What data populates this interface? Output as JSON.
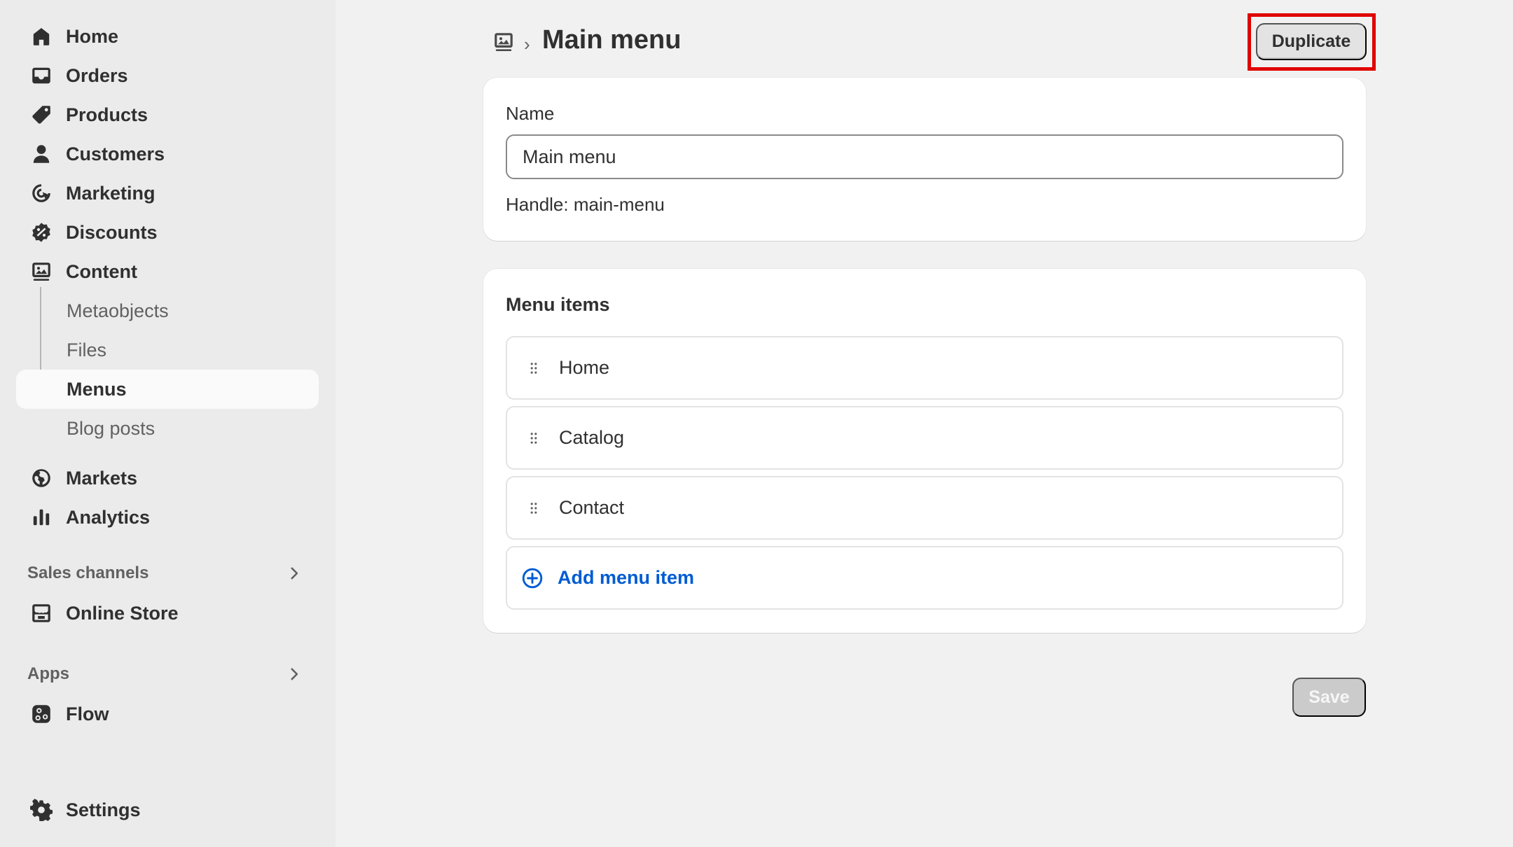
{
  "sidebar": {
    "items": [
      {
        "label": "Home",
        "icon": "home-icon"
      },
      {
        "label": "Orders",
        "icon": "inbox-icon"
      },
      {
        "label": "Products",
        "icon": "tag-icon"
      },
      {
        "label": "Customers",
        "icon": "person-icon"
      },
      {
        "label": "Marketing",
        "icon": "target-icon"
      },
      {
        "label": "Discounts",
        "icon": "discount-icon"
      },
      {
        "label": "Content",
        "icon": "content-icon"
      }
    ],
    "content_sub": [
      {
        "label": "Metaobjects"
      },
      {
        "label": "Files"
      },
      {
        "label": "Menus",
        "active": true
      },
      {
        "label": "Blog posts"
      }
    ],
    "items2": [
      {
        "label": "Markets",
        "icon": "globe-icon"
      },
      {
        "label": "Analytics",
        "icon": "bar-chart-icon"
      }
    ],
    "sales_channels": {
      "header": "Sales channels",
      "items": [
        {
          "label": "Online Store",
          "icon": "store-icon"
        }
      ]
    },
    "apps": {
      "header": "Apps",
      "items": [
        {
          "label": "Flow",
          "icon": "flow-icon"
        }
      ]
    },
    "settings": {
      "label": "Settings",
      "icon": "gear-icon"
    }
  },
  "header": {
    "breadcrumb_icon": "content-icon",
    "separator": "›",
    "title": "Main menu",
    "duplicate_label": "Duplicate"
  },
  "name_card": {
    "label": "Name",
    "value": "Main menu",
    "handle_text": "Handle: main-menu"
  },
  "menu_card": {
    "title": "Menu items",
    "items": [
      {
        "label": "Home"
      },
      {
        "label": "Catalog"
      },
      {
        "label": "Contact"
      }
    ],
    "add_label": "Add menu item"
  },
  "footer": {
    "save_label": "Save"
  },
  "colors": {
    "accent_link": "#005bd3",
    "highlight": "#e00000"
  }
}
